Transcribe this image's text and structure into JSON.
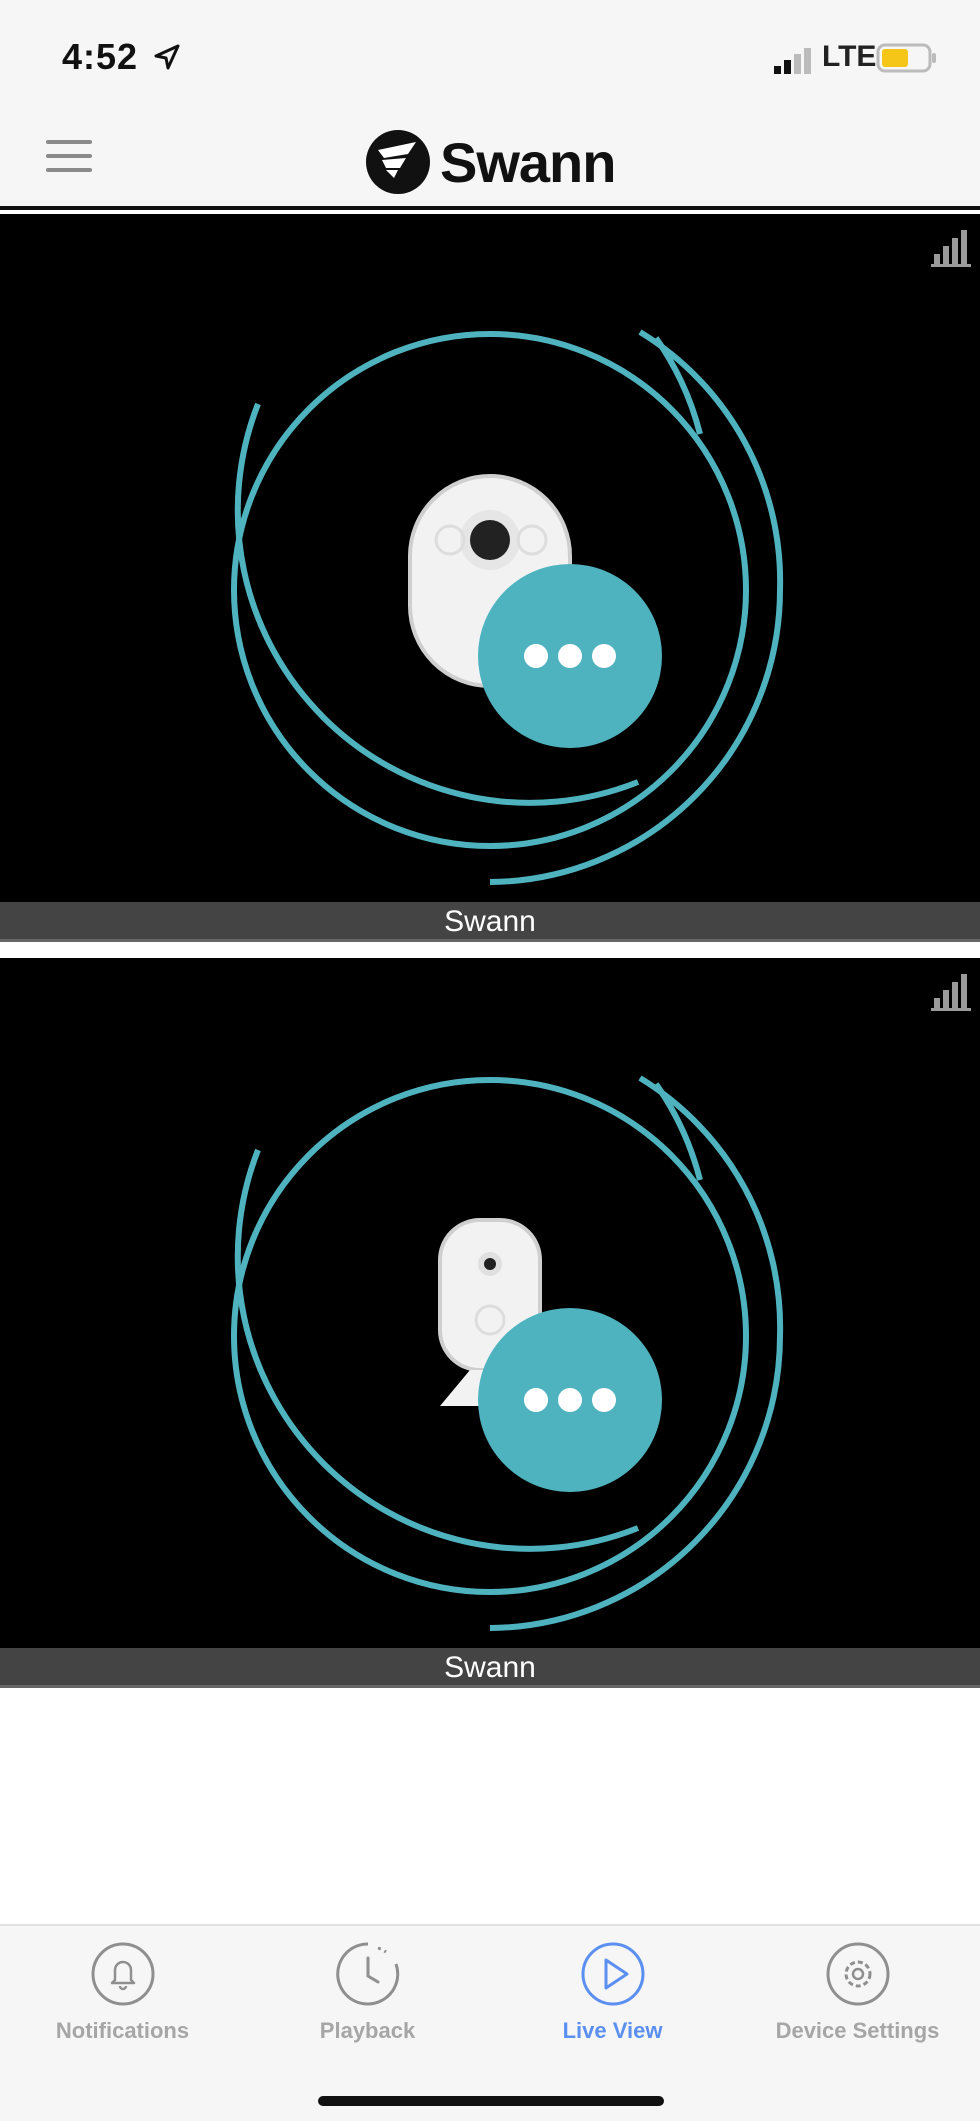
{
  "status_bar": {
    "time": "4:52",
    "network": "LTE",
    "battery_color": "#f5c518"
  },
  "header": {
    "brand": "Swann",
    "menu_icon": "hamburger-menu-icon"
  },
  "cameras": [
    {
      "label": "Swann",
      "icon": "signal-bars-icon",
      "device": "wire-free-camera",
      "action_icon": "more-dots-icon"
    },
    {
      "label": "Swann",
      "icon": "signal-bars-icon",
      "device": "indoor-camera",
      "action_icon": "more-dots-icon"
    }
  ],
  "tabs": [
    {
      "label": "Notifications",
      "icon": "bell-icon",
      "active": false
    },
    {
      "label": "Playback",
      "icon": "clock-icon",
      "active": false
    },
    {
      "label": "Live View",
      "icon": "play-icon",
      "active": true
    },
    {
      "label": "Device Settings",
      "icon": "gear-icon",
      "active": false
    }
  ],
  "colors": {
    "accent": "#4fb3bf",
    "tab_active": "#5b8ff0",
    "tab_inactive": "#a6a6a6"
  }
}
